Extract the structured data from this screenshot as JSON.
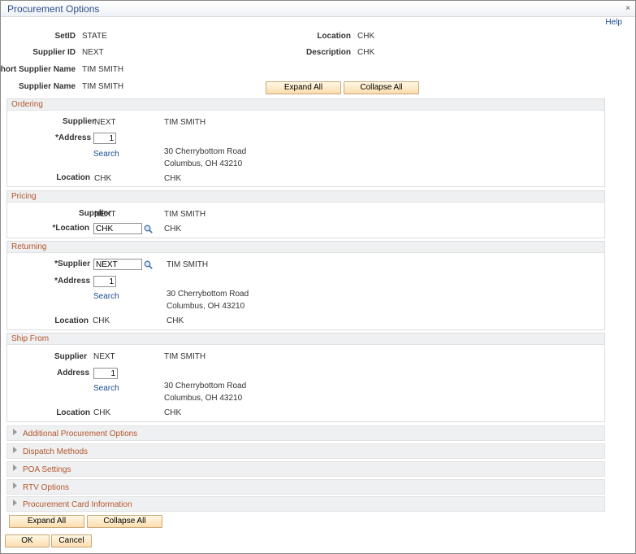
{
  "window": {
    "title": "Procurement Options",
    "close": "×",
    "help": "Help"
  },
  "header": {
    "setid_label": "SetID",
    "setid": "STATE",
    "supplier_id_label": "Supplier ID",
    "supplier_id": "NEXT",
    "short_name_label": "Short Supplier Name",
    "short_name": "TIM SMITH",
    "name_label": "Supplier Name",
    "name": "TIM SMITH",
    "location_label": "Location",
    "location": "CHK",
    "description_label": "Description",
    "description": "CHK"
  },
  "buttons": {
    "expand_all": "Expand All",
    "collapse_all": "Collapse All",
    "ok": "OK",
    "cancel": "Cancel"
  },
  "ordering": {
    "title": "Ordering",
    "supplier_label": "Supplier",
    "supplier": "NEXT",
    "supplier_name": "TIM SMITH",
    "address_label": "*Address",
    "address": "1",
    "search": "Search",
    "addr_line1": "30 Cherrybottom Road",
    "addr_line2": "Columbus, OH  43210",
    "location_label": "Location",
    "location": "CHK",
    "location_desc": "CHK"
  },
  "pricing": {
    "title": "Pricing",
    "supplier_label": "Supplier",
    "supplier": "NEXT",
    "supplier_name": "TIM SMITH",
    "location_label": "*Location",
    "location": "CHK",
    "location_desc": "CHK"
  },
  "returning": {
    "title": "Returning",
    "supplier_label": "*Supplier",
    "supplier": "NEXT",
    "supplier_name": "TIM SMITH",
    "address_label": "*Address",
    "address": "1",
    "search": "Search",
    "addr_line1": "30 Cherrybottom Road",
    "addr_line2": "Columbus, OH  43210",
    "location_label": "Location",
    "location": "CHK",
    "location_desc": "CHK"
  },
  "ship_from": {
    "title": "Ship From",
    "supplier_label": "Supplier",
    "supplier": "NEXT",
    "supplier_name": "TIM SMITH",
    "address_label": "Address",
    "address": "1",
    "search": "Search",
    "addr_line1": "30 Cherrybottom Road",
    "addr_line2": "Columbus, OH  43210",
    "location_label": "Location",
    "location": "CHK",
    "location_desc": "CHK"
  },
  "collapsed_sections": [
    "Additional Procurement Options",
    "Dispatch Methods",
    "POA Settings",
    "RTV Options",
    "Procurement Card Information"
  ]
}
